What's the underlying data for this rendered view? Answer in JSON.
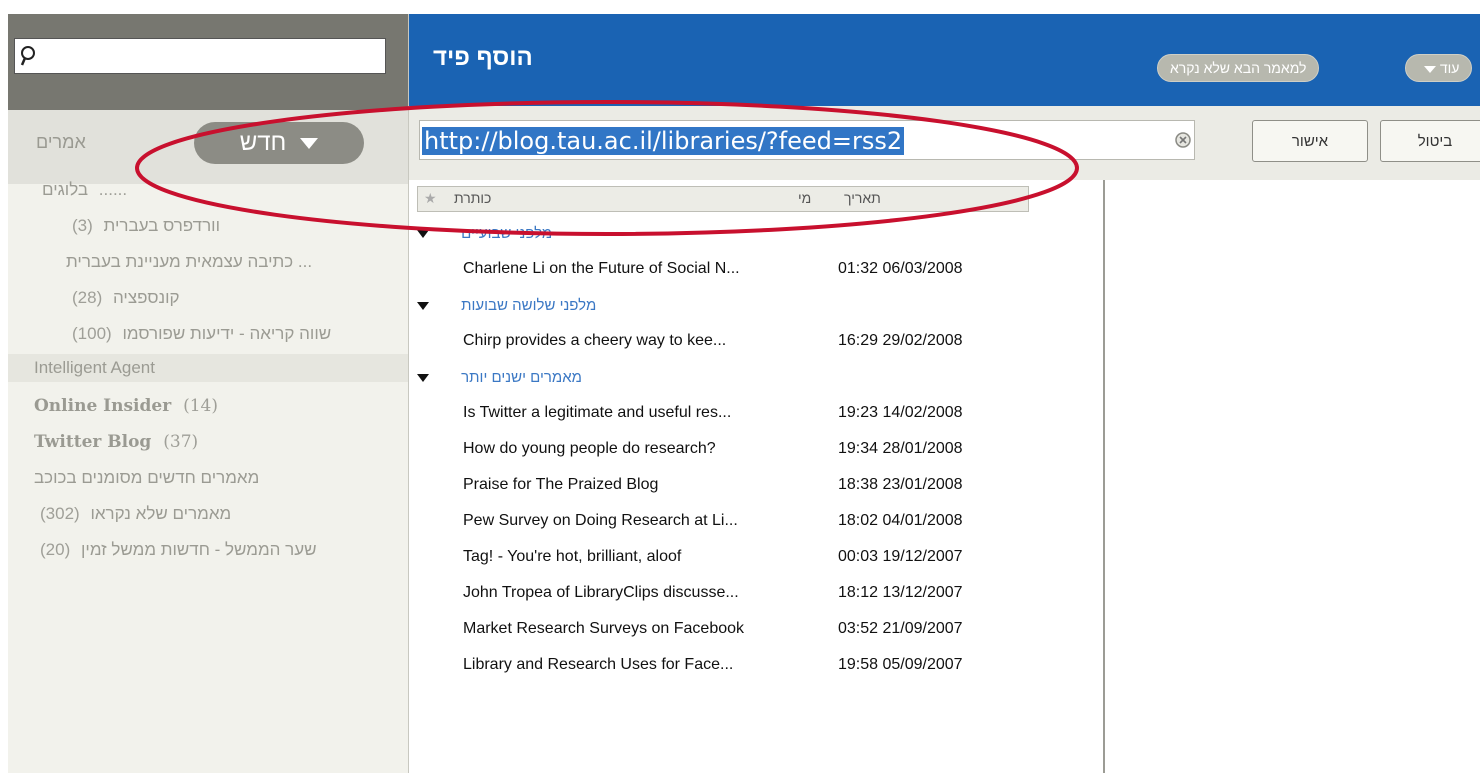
{
  "sidebar": {
    "articles_label": "אמרים",
    "new_button": "חדש",
    "tree": [
      {
        "label": "בלוגים",
        "count": "",
        "prefix": "......"
      },
      {
        "label": "וורדפרס בעברית",
        "count": "(3)"
      },
      {
        "label": "כתיבה עצמאית מעניינת בעברית ...",
        "count": ""
      },
      {
        "label": "קונספציה",
        "count": "(28)"
      },
      {
        "label": "שווה קריאה - ידיעות שפורסמו",
        "count": "(100)"
      },
      {
        "label": "Intelligent Agent",
        "count": ""
      },
      {
        "label": "Online Insider",
        "count": "(14)"
      },
      {
        "label": "Twitter Blog",
        "count": "(37)"
      },
      {
        "label": "מאמרים חדשים מסומנים בכוכב",
        "count": ""
      },
      {
        "label": "מאמרים שלא נקראו",
        "count": "(302)"
      },
      {
        "label": "שער הממשל - חדשות ממשל זמין",
        "count": "(20)"
      }
    ]
  },
  "header": {
    "title": "הוסף פיד",
    "more_label": "עוד",
    "next_unread_label": "למאמר הבא שלא נקרא"
  },
  "urlbar": {
    "url": "http://blog.tau.ac.il/libraries/?feed=rss2",
    "ok_label": "אישור",
    "cancel_label": "ביטול"
  },
  "list": {
    "columns": {
      "title": "כותרת",
      "date": "תאריך",
      "star": "★",
      "author": "מי"
    },
    "groups": [
      {
        "label": "מלפני שבועיים",
        "items": [
          {
            "title": "Charlene Li on the Future of Social N...",
            "date": "01:32 06/03/2008"
          }
        ]
      },
      {
        "label": "מלפני שלושה שבועות",
        "items": [
          {
            "title": "Chirp provides a cheery way to kee...",
            "date": "16:29 29/02/2008"
          }
        ]
      },
      {
        "label": "מאמרים ישנים יותר",
        "items": [
          {
            "title": "Is Twitter a legitimate and useful res...",
            "date": "19:23 14/02/2008"
          },
          {
            "title": "How do young people do research?",
            "date": "19:34 28/01/2008"
          },
          {
            "title": "Praise for The Praized Blog",
            "date": "18:38 23/01/2008"
          },
          {
            "title": "Pew Survey on Doing Research at Li...",
            "date": "18:02 04/01/2008"
          },
          {
            "title": "Tag! - You're hot, brilliant, aloof",
            "date": "00:03 19/12/2007"
          },
          {
            "title": "John Tropea of LibraryClips discusse...",
            "date": "18:12 13/12/2007"
          },
          {
            "title": "Market Research Surveys on Facebook",
            "date": "03:52 21/09/2007"
          },
          {
            "title": "Library and Research Uses for Face...",
            "date": "19:58 05/09/2007"
          }
        ]
      }
    ]
  },
  "colors": {
    "header_blue": "#1a63b3",
    "selection_blue": "#3176c6",
    "annotation_red": "#c8102e",
    "group_blue": "#3b78c4"
  },
  "icons": {
    "search": "magnifier-icon",
    "clear": "circle-x-icon",
    "dropdown": "triangle-down-icon"
  }
}
